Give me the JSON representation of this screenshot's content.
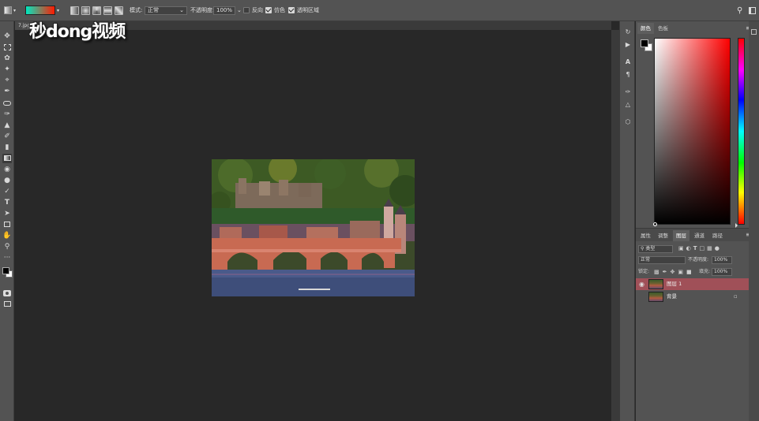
{
  "options_bar": {
    "mode_label": "模式:",
    "mode_value": "正常",
    "opacity_label": "不透明度:",
    "opacity_value": "100%",
    "reverse_label": "反向",
    "dither_label": "仿色",
    "transparency_label": "透明区域",
    "reverse_checked": false,
    "dither_checked": true,
    "transparency_checked": true
  },
  "document": {
    "tab_title": "7.jpg"
  },
  "watermark": {
    "text": "秒dong视频"
  },
  "color_panel": {
    "tabs": [
      "颜色",
      "色板"
    ],
    "foreground": "#000000",
    "background": "#ffffff"
  },
  "layers_panel": {
    "tabs": [
      "属性",
      "调整",
      "图层",
      "通道",
      "路径"
    ],
    "active_tab": "图层",
    "filter_kind": "类型",
    "blend_mode": "正常",
    "opacity_label": "不透明度:",
    "opacity_value": "100%",
    "lock_label": "锁定:",
    "fill_label": "填充:",
    "fill_value": "100%",
    "layers": [
      {
        "name": "图层 1",
        "selected": true
      },
      {
        "name": "背景",
        "selected": false
      }
    ]
  },
  "colors": {
    "accent_gradient_start": "#00e8c0",
    "accent_gradient_end": "#ff1a00",
    "selected_layer": "#a05058"
  },
  "icons": [
    "move-icon",
    "marquee-icon",
    "lasso-icon",
    "magic-wand-icon",
    "crop-icon",
    "eyedropper-icon",
    "healing-icon",
    "brush-icon",
    "stamp-icon",
    "history-brush-icon",
    "eraser-icon",
    "gradient-icon",
    "blur-icon",
    "dodge-icon",
    "pen-icon",
    "type-icon",
    "path-select-icon",
    "rectangle-icon",
    "hand-icon",
    "zoom-icon",
    "more-icon",
    "swap-colors-icon",
    "quick-mask-icon",
    "screen-mode-icon",
    "search-icon",
    "workspace-icon"
  ]
}
